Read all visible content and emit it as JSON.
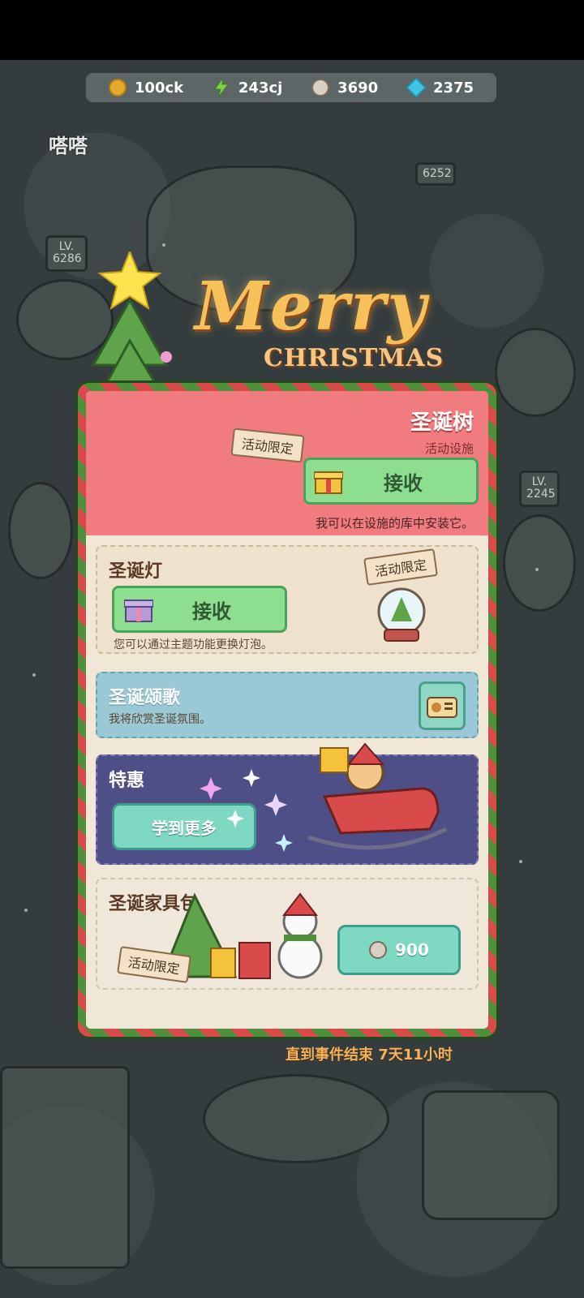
{
  "resources": {
    "coins": "100ck",
    "energy": "243cj",
    "gears": "3690",
    "gems": "2375"
  },
  "logo": "嗒嗒",
  "scene_signs": {
    "sign_top_right": "6252",
    "sign_left": "LV.\n6286",
    "sign_right": "LV.\n2245"
  },
  "title": {
    "merry": "Merry",
    "christmas": "CHRISTMAS"
  },
  "tree_card": {
    "title": "圣诞树",
    "subtitle": "活动设施",
    "tag": "活动限定",
    "receive_label": "接收",
    "desc": "我可以在设施的库中安装它。"
  },
  "lights_card": {
    "title": "圣诞灯",
    "tag": "活动限定",
    "receive_label": "接收",
    "desc": "您可以通过主题功能更换灯泡。"
  },
  "carol_card": {
    "title": "圣诞颂歌",
    "desc": "我将欣赏圣诞氛围。"
  },
  "deal_card": {
    "title": "特惠",
    "button_label": "学到更多"
  },
  "furniture_card": {
    "title": "圣诞家具包",
    "tag": "活动限定",
    "price": "900"
  },
  "timer": "直到事件结束 7天11小时",
  "colors": {
    "panel_red": "#d94b4b",
    "panel_green": "#4f8f3c",
    "button_green": "#8ede8f",
    "button_teal": "#7ed8c2",
    "title_gold": "#f6c15a"
  }
}
